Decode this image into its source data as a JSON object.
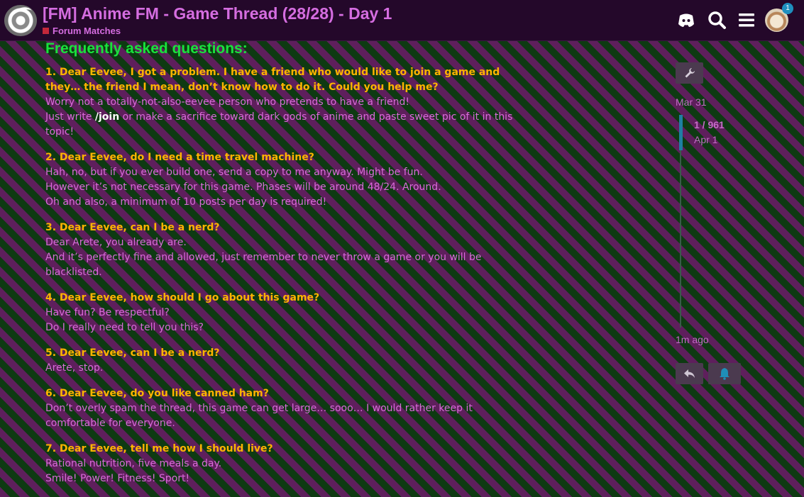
{
  "header": {
    "title": "[FM] Anime FM - Game Thread (28/28) - Day 1",
    "category": "Forum Matches",
    "category_color": "#c4283a",
    "notification_count": "1",
    "icons": [
      "discord-icon",
      "search-icon",
      "hamburger-menu-icon"
    ]
  },
  "faq": {
    "heading": "Frequently asked questions:",
    "items": [
      {
        "q": "1. Dear Eevee, I got a problem. I have a friend who would like to join a game and they… the friend I mean, don’t know how to do it. Could you help me?",
        "a1": "Worry not a totally-not-also-eevee person who pretends to have a friend!",
        "a2_pre": "Just write ",
        "a2_cmd": "/join",
        "a2_post": " or make a sacrifice toward dark gods of anime and paste sweet pic of it in this topic!"
      },
      {
        "q": "2. Dear Eevee, do I need a time travel machine?",
        "lines": [
          "Hah, no, but if you ever build one, send a copy to me anyway. Might be fun.",
          "However it’s not necessary for this game. Phases will be around 48/24. Around.",
          "Oh and also, a minimum of 10 posts per day is required!"
        ]
      },
      {
        "q": "3. Dear Eevee, can I be a nerd?",
        "lines": [
          "Dear Arete, you already are.",
          "And it’s perfectly fine and allowed, just remember to never throw a game or you will be blacklisted."
        ]
      },
      {
        "q": "4. Dear Eevee, how should I go about this game?",
        "lines": [
          "Have fun? Be respectful?",
          "Do I really need to tell you this?"
        ]
      },
      {
        "q": "5. Dear Eevee, can I be a nerd?",
        "lines": [
          "Arete, stop."
        ]
      },
      {
        "q": "6. Dear Eevee, do you like canned ham?",
        "lines": [
          "Don’t overly spam the thread, this game can get large… sooo… I would rather keep it comfortable for everyone."
        ]
      },
      {
        "q": "7. Dear Eevee, tell me how I should live?",
        "lines": [
          "Rational nutrition, five meals a day.",
          "Smile! Power! Fitness! Sport!"
        ]
      }
    ]
  },
  "timeline": {
    "start_date": "Mar 31",
    "position": "1 / 961",
    "position_date": "Apr 1",
    "end_date": "1m ago",
    "progress_fraction": 0.001
  },
  "actions": {
    "reply_icon": "reply-icon",
    "notification_icon": "bell-icon"
  }
}
